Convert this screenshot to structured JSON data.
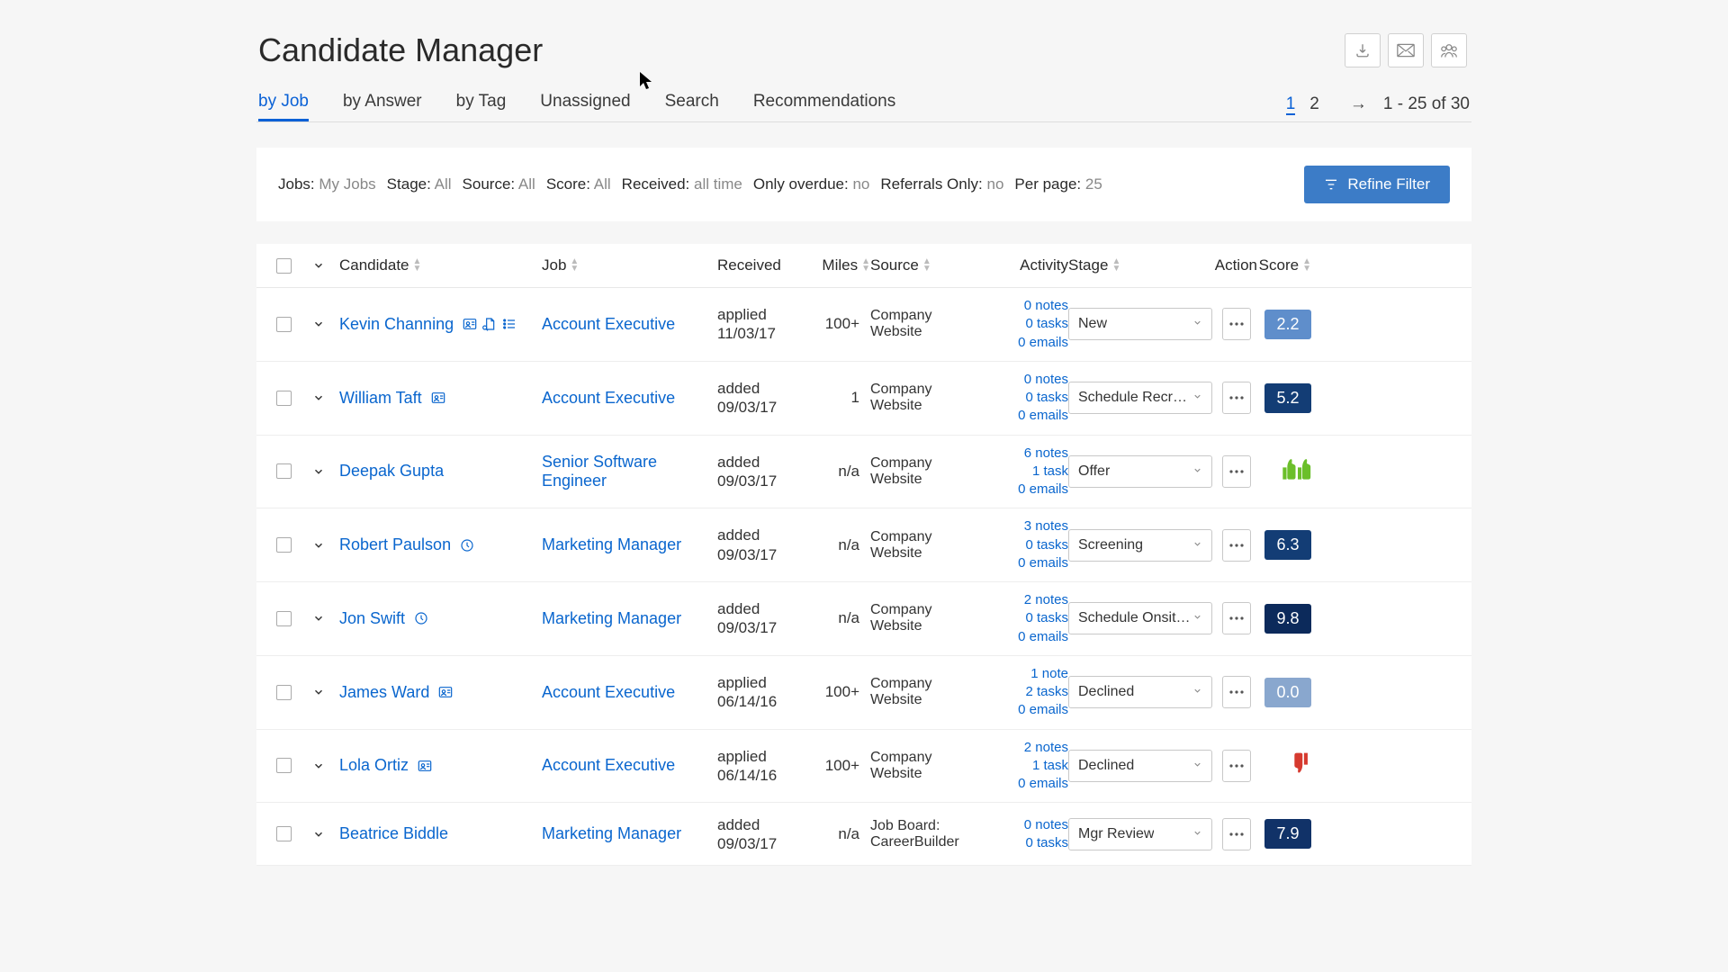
{
  "title": "Candidate Manager",
  "tabs": [
    "by Job",
    "by Answer",
    "by Tag",
    "Unassigned",
    "Search",
    "Recommendations"
  ],
  "active_tab": 0,
  "paging": {
    "pages": [
      "1",
      "2"
    ],
    "active": 0,
    "range": "1 - 25 of 30"
  },
  "filters": [
    {
      "label": "Jobs:",
      "value": "My Jobs"
    },
    {
      "label": "Stage:",
      "value": "All"
    },
    {
      "label": "Source:",
      "value": "All"
    },
    {
      "label": "Score:",
      "value": "All"
    },
    {
      "label": "Received:",
      "value": "all time"
    },
    {
      "label": "Only overdue:",
      "value": "no"
    },
    {
      "label": "Referrals Only:",
      "value": "no"
    },
    {
      "label": "Per page:",
      "value": "25"
    }
  ],
  "refine_label": "Refine Filter",
  "columns": [
    "Candidate",
    "Job",
    "Received",
    "Miles",
    "Source",
    "Activity",
    "Stage",
    "Action",
    "Score"
  ],
  "rows": [
    {
      "name": "Kevin Channing",
      "icons": [
        "id-card",
        "doc-search",
        "list"
      ],
      "job": "Account Executive",
      "received_status": "applied",
      "received_date": "11/03/17",
      "miles": "100+",
      "source": "Company Website",
      "activity": [
        "0 notes",
        "0 tasks",
        "0 emails"
      ],
      "stage": "New",
      "score": "2.2",
      "score_color": "#5f8ecb",
      "score_type": "num"
    },
    {
      "name": "William Taft",
      "icons": [
        "id-card"
      ],
      "job": "Account Executive",
      "received_status": "added",
      "received_date": "09/03/17",
      "miles": "1",
      "source": "Company Website",
      "activity": [
        "0 notes",
        "0 tasks",
        "0 emails"
      ],
      "stage": "Schedule Recruit...",
      "score": "5.2",
      "score_color": "#133d75",
      "score_type": "num"
    },
    {
      "name": "Deepak Gupta",
      "icons": [],
      "job": "Senior Software Engineer",
      "received_status": "added",
      "received_date": "09/03/17",
      "miles": "n/a",
      "source": "Company Website",
      "activity": [
        "6 notes",
        "1 task",
        "0 emails"
      ],
      "stage": "Offer",
      "score": "",
      "score_color": "",
      "score_type": "thumbs-up"
    },
    {
      "name": "Robert Paulson",
      "icons": [
        "clock"
      ],
      "job": "Marketing Manager",
      "received_status": "added",
      "received_date": "09/03/17",
      "miles": "n/a",
      "source": "Company Website",
      "activity": [
        "3 notes",
        "0 tasks",
        "0 emails"
      ],
      "stage": "Screening",
      "score": "6.3",
      "score_color": "#133d75",
      "score_type": "num"
    },
    {
      "name": "Jon Swift",
      "icons": [
        "clock"
      ],
      "job": "Marketing Manager",
      "received_status": "added",
      "received_date": "09/03/17",
      "miles": "n/a",
      "source": "Company Website",
      "activity": [
        "2 notes",
        "0 tasks",
        "0 emails"
      ],
      "stage": "Schedule Onsite I...",
      "score": "9.8",
      "score_color": "#0c2a5b",
      "score_type": "num"
    },
    {
      "name": "James Ward",
      "icons": [
        "id-card"
      ],
      "job": "Account Executive",
      "received_status": "applied",
      "received_date": "06/14/16",
      "miles": "100+",
      "source": "Company Website",
      "activity": [
        "1 note",
        "2 tasks",
        "0 emails"
      ],
      "stage": "Declined",
      "score": "0.0",
      "score_color": "#89a7ce",
      "score_type": "num"
    },
    {
      "name": "Lola Ortiz",
      "icons": [
        "id-card"
      ],
      "job": "Account Executive",
      "received_status": "applied",
      "received_date": "06/14/16",
      "miles": "100+",
      "source": "Company Website",
      "activity": [
        "2 notes",
        "1 task",
        "0 emails"
      ],
      "stage": "Declined",
      "score": "",
      "score_color": "",
      "score_type": "thumbs-down"
    },
    {
      "name": "Beatrice Biddle",
      "icons": [],
      "job": "Marketing Manager",
      "received_status": "added",
      "received_date": "09/03/17",
      "miles": "n/a",
      "source": "Job Board: CareerBuilder",
      "activity": [
        "0 notes",
        "0 tasks"
      ],
      "stage": "Mgr Review",
      "score": "7.9",
      "score_color": "#113268",
      "score_type": "num"
    }
  ]
}
